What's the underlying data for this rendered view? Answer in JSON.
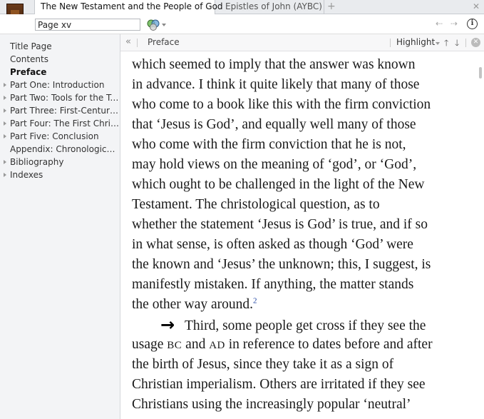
{
  "tabs": [
    {
      "label": "The New Testament and the People of God",
      "active": true
    },
    {
      "label": "Epistles of John (AYBC)",
      "active": false
    }
  ],
  "toolbar": {
    "page_value": "Page xv"
  },
  "sidebar": {
    "items": [
      {
        "label": "Title Page",
        "expandable": false,
        "bold": false
      },
      {
        "label": "Contents",
        "expandable": false,
        "bold": false
      },
      {
        "label": "Preface",
        "expandable": false,
        "bold": true
      },
      {
        "label": "Part One: Introduction",
        "expandable": true,
        "bold": false
      },
      {
        "label": "Part Two: Tools for the Task",
        "expandable": true,
        "bold": false
      },
      {
        "label": "Part Three: First-Century…",
        "expandable": true,
        "bold": false
      },
      {
        "label": "Part Four: The First Chris…",
        "expandable": true,
        "bold": false
      },
      {
        "label": "Part Five: Conclusion",
        "expandable": true,
        "bold": false
      },
      {
        "label": "Appendix: Chronological…",
        "expandable": false,
        "bold": false
      },
      {
        "label": "Bibliography",
        "expandable": true,
        "bold": false
      },
      {
        "label": "Indexes",
        "expandable": true,
        "bold": false
      }
    ]
  },
  "content_header": {
    "section": "Preface",
    "highlight_label": "Highlight"
  },
  "text": {
    "lines": [
      "which seemed to imply that the answer was known",
      "in advance. I think it quite likely that many of those",
      "who come to a book like this with the firm conviction",
      "that ‘Jesus is God’, and equally well many of those",
      "who come with the firm conviction that he is not,",
      "may hold views on the meaning of ‘god’, or ‘God’,",
      "which ought to be challenged in the light of the New",
      "Testament. The christological question, as to",
      "whether the statement ‘Jesus is God’ is true, and if so",
      "in what sense, is often asked as though ‘God’ were",
      "the known and ‘Jesus’ the unknown; this, I suggest, is",
      "manifestly mistaken. If anything, the matter stands"
    ],
    "last_line": "the other way around.",
    "footnote": "2",
    "para2_line1": "Third, some people get cross if they see the",
    "para2_line2_a": "usage ",
    "para2_bc": "BC",
    "para2_line2_b": " and ",
    "para2_ad": "AD",
    "para2_line2_c": " in reference to dates before and after",
    "para2_lines_rest": [
      "the birth of Jesus, since they take it as a sign of",
      "Christian imperialism. Others are irritated if they see",
      "Christians using the increasingly popular ‘neutral’"
    ]
  }
}
